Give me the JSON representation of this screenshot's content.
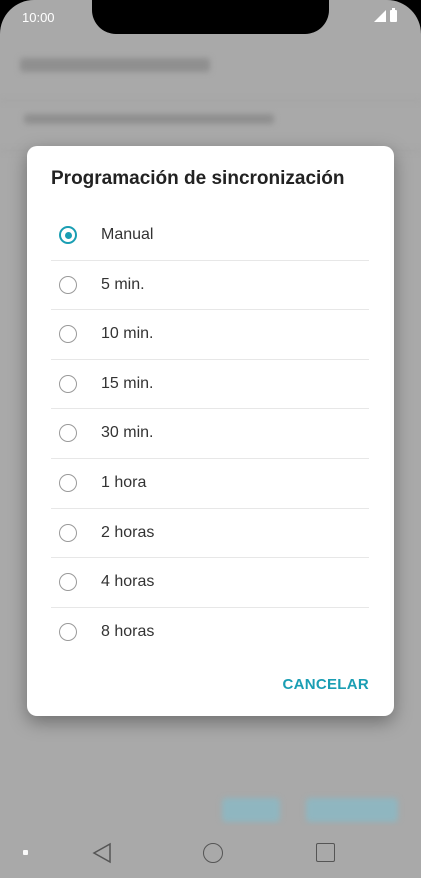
{
  "status_bar": {
    "time": "10:00"
  },
  "dialog": {
    "title": "Programación de sincronización",
    "options": [
      {
        "label": "Manual",
        "selected": true
      },
      {
        "label": "5 min.",
        "selected": false
      },
      {
        "label": "10 min.",
        "selected": false
      },
      {
        "label": "15 min.",
        "selected": false
      },
      {
        "label": "30 min.",
        "selected": false
      },
      {
        "label": "1 hora",
        "selected": false
      },
      {
        "label": "2 horas",
        "selected": false
      },
      {
        "label": "4 horas",
        "selected": false
      },
      {
        "label": "8 horas",
        "selected": false
      }
    ],
    "cancel_label": "CANCELAR"
  },
  "colors": {
    "accent": "#1a9eb3",
    "scrim": "#a9a9a9"
  },
  "icons": {
    "back": "back-icon",
    "home": "home-icon",
    "recents": "recents-icon"
  }
}
